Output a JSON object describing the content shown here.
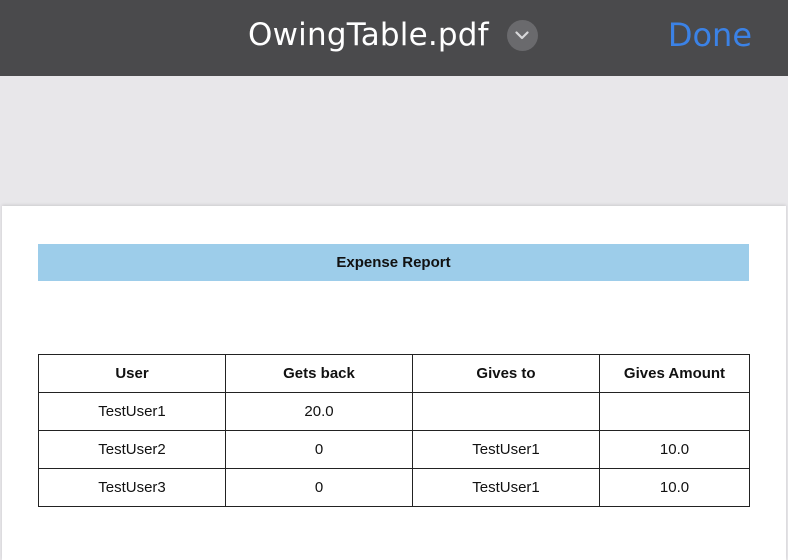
{
  "header": {
    "title": "OwingTable.pdf",
    "done_label": "Done",
    "chevron_icon": "chevron-down-icon"
  },
  "document": {
    "banner_title": "Expense Report",
    "table": {
      "columns": [
        "User",
        "Gets back",
        "Gives to",
        "Gives Amount"
      ],
      "rows": [
        [
          "TestUser1",
          "20.0",
          "",
          ""
        ],
        [
          "TestUser2",
          "0",
          "TestUser1",
          "10.0"
        ],
        [
          "TestUser3",
          "0",
          "TestUser1",
          "10.0"
        ]
      ]
    }
  },
  "colors": {
    "topbar": "#4a4a4c",
    "done_accent": "#3b82e6",
    "banner": "#9dcdea",
    "background": "#e8e7ea"
  }
}
